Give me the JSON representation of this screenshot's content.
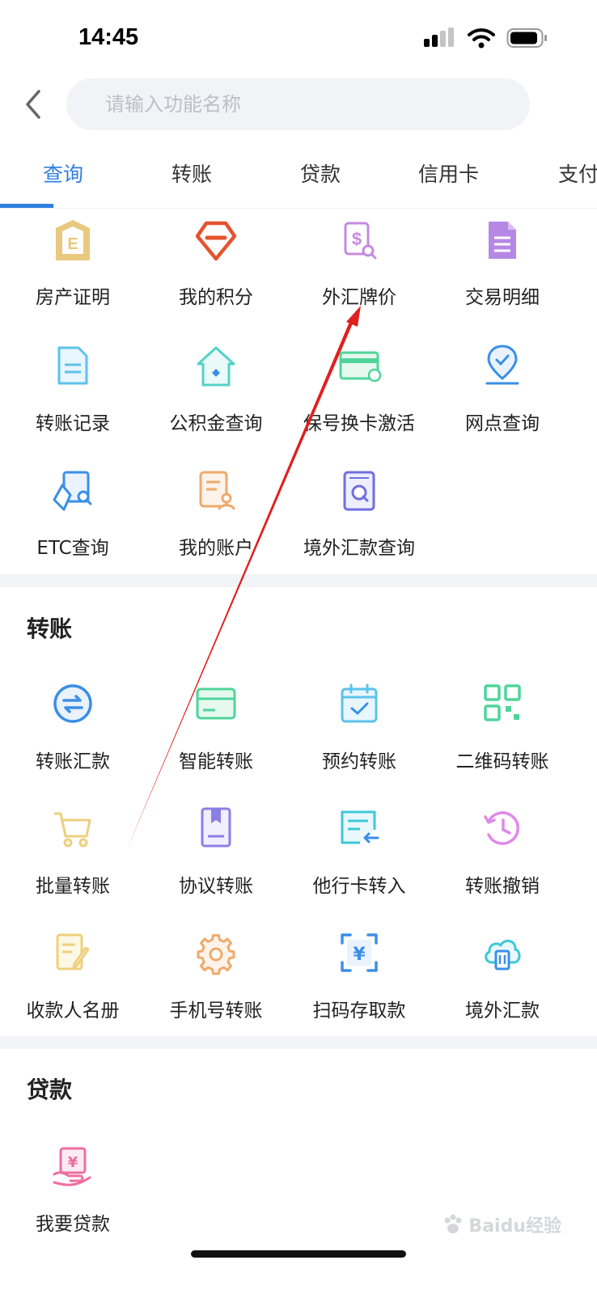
{
  "status": {
    "time": "14:45"
  },
  "search": {
    "placeholder": "请输入功能名称"
  },
  "tabs": [
    "查询",
    "转账",
    "贷款",
    "信用卡",
    "支付"
  ],
  "query_items": [
    {
      "label": "房产证明",
      "icon": "property-certificate-icon"
    },
    {
      "label": "我的积分",
      "icon": "points-diamond-icon"
    },
    {
      "label": "外汇牌价",
      "icon": "forex-rate-icon"
    },
    {
      "label": "交易明细",
      "icon": "transaction-detail-icon"
    },
    {
      "label": "转账记录",
      "icon": "transfer-record-icon"
    },
    {
      "label": "公积金查询",
      "icon": "housing-fund-icon"
    },
    {
      "label": "保号换卡激活",
      "icon": "card-activation-icon"
    },
    {
      "label": "网点查询",
      "icon": "branch-location-icon"
    },
    {
      "label": "ETC查询",
      "icon": "etc-query-icon"
    },
    {
      "label": "我的账户",
      "icon": "my-account-icon"
    },
    {
      "label": "境外汇款查询",
      "icon": "overseas-remittance-query-icon"
    }
  ],
  "transfer_section": {
    "title": "转账"
  },
  "transfer_items": [
    {
      "label": "转账汇款",
      "icon": "transfer-remit-icon"
    },
    {
      "label": "智能转账",
      "icon": "smart-transfer-icon"
    },
    {
      "label": "预约转账",
      "icon": "scheduled-transfer-icon"
    },
    {
      "label": "二维码转账",
      "icon": "qrcode-transfer-icon"
    },
    {
      "label": "批量转账",
      "icon": "batch-transfer-cart-icon"
    },
    {
      "label": "协议转账",
      "icon": "agreement-transfer-icon"
    },
    {
      "label": "他行卡转入",
      "icon": "other-bank-transfer-in-icon"
    },
    {
      "label": "转账撤销",
      "icon": "transfer-revoke-icon"
    },
    {
      "label": "收款人名册",
      "icon": "payee-list-icon"
    },
    {
      "label": "手机号转账",
      "icon": "phone-transfer-gear-icon"
    },
    {
      "label": "扫码存取款",
      "icon": "scan-deposit-icon"
    },
    {
      "label": "境外汇款",
      "icon": "overseas-remittance-cloud-icon"
    }
  ],
  "loan_section": {
    "title": "贷款"
  },
  "loan_items": [
    {
      "label": "我要贷款",
      "icon": "apply-loan-icon"
    }
  ],
  "watermark": {
    "text": "Baidu经验"
  },
  "colors": {
    "accent": "#2f7fe0",
    "arrow": "#e01f1f"
  }
}
